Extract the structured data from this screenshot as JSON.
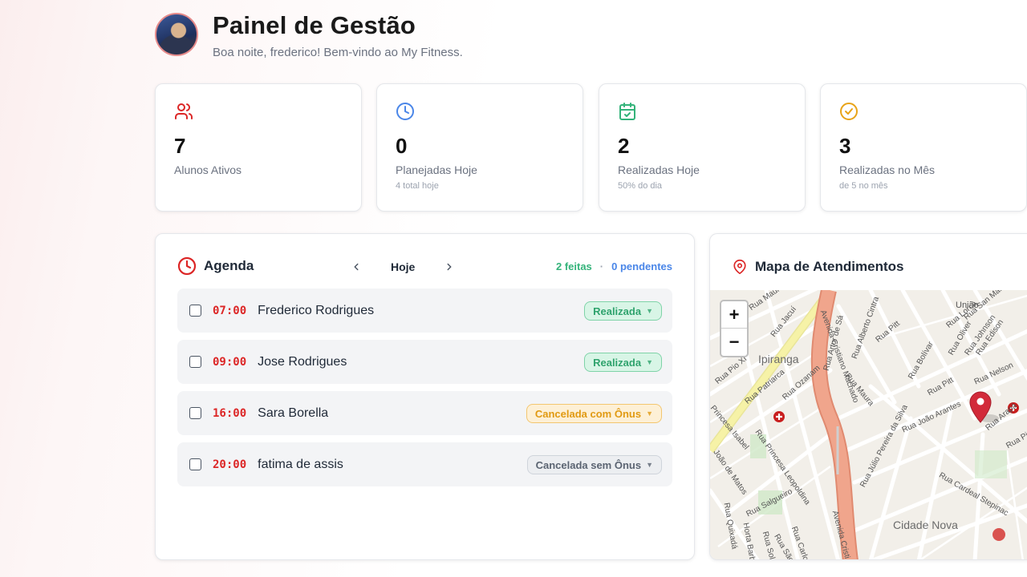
{
  "header": {
    "title": "Painel de Gestão",
    "subtitle": "Boa noite, frederico! Bem-vindo ao My Fitness."
  },
  "stats": [
    {
      "icon": "users-icon",
      "value": "7",
      "label": "Alunos Ativos",
      "sub": "",
      "color": "#dc2626"
    },
    {
      "icon": "clock-icon",
      "value": "0",
      "label": "Planejadas Hoje",
      "sub": "4 total hoje",
      "color": "#4a86e8"
    },
    {
      "icon": "calendar-check-icon",
      "value": "2",
      "label": "Realizadas Hoje",
      "sub": "50% do dia",
      "color": "#34b37a"
    },
    {
      "icon": "check-circle-icon",
      "value": "3",
      "label": "Realizadas no Mês",
      "sub": "de 5 no mês",
      "color": "#e8a317"
    }
  ],
  "agenda": {
    "title": "Agenda",
    "day_label": "Hoje",
    "done_summary": "2 feitas",
    "separator": "·",
    "pending_summary": "0 pendentes",
    "appointments": [
      {
        "time": "07:00",
        "name": "Frederico Rodrigues",
        "status": "Realizada"
      },
      {
        "time": "09:00",
        "name": "Jose Rodrigues",
        "status": "Realizada"
      },
      {
        "time": "16:00",
        "name": "Sara Borella",
        "status": "Cancelada com Ônus"
      },
      {
        "time": "20:00",
        "name": "fatima de assis",
        "status": "Cancelada sem Ônus"
      }
    ]
  },
  "map": {
    "title": "Mapa de Atendimentos",
    "zoom_in": "+",
    "zoom_out": "−",
    "labels": {
      "ipiranga": "Ipiranga",
      "cidade_nova": "Cidade Nova",
      "uniao": "União",
      "av_cristiano": "Avenida Cristiano Machado",
      "av_cristiano_2": "Avenida Cristi",
      "rua_jacui": "Rua Jacuí",
      "rua_maura": "Rua Maura",
      "rua_maura_2": "Rua Maura",
      "rua_pitt": "Rua Pitt",
      "rua_pitt_2": "Rua Pitt",
      "rua_pitt_3": "Rua Pitt",
      "rua_bolivar": "Rua Bolívar",
      "rua_lorca": "Rua Lorca",
      "rua_oliver": "Rua Oliver",
      "rua_johnson": "Rua Johnson",
      "rua_edison": "Rua Edison",
      "rua_nelson": "Rua Nelson",
      "rua_san_martin": "Rua San Martin",
      "rua_artur_de_sa": "Rua Artur de Sá",
      "rua_alberto_cintra": "Rua Alberto Cintra",
      "rua_ozanam": "Rua Ozanam",
      "rua_patriarca": "Rua Patriarca",
      "rua_pio_xi": "Rua Pio XI",
      "rua_princesa_isabel": "Princesa Isabel",
      "rua_princesa_leopoldina": "Rua Princesa Leopoldina",
      "rua_joao_de_matos": "João de Matos",
      "rua_joao_arantes": "Rua João Arantes",
      "rua_julio_pereira": "Rua Júlio Pereira da Silva",
      "rua_cardeal_stepinac": "Rua Cardeal Stepinac",
      "rua_arapa": "Rua Arapá",
      "rua_salgueiro": "Rua Salgueiro",
      "rua_quixada": "Rua Quixadá",
      "rua_carlos_t": "Rua Carlos T",
      "rua_sao": "Rua São",
      "horta_barbosa": "Horta Barbosa",
      "rua_do_sol": "Rua Sol"
    },
    "colors": {
      "avenue": "#f0a58c",
      "avenue_edge": "#e08a70",
      "yellow_road": "#f6f2a7",
      "marker": "#d22a3a"
    }
  }
}
